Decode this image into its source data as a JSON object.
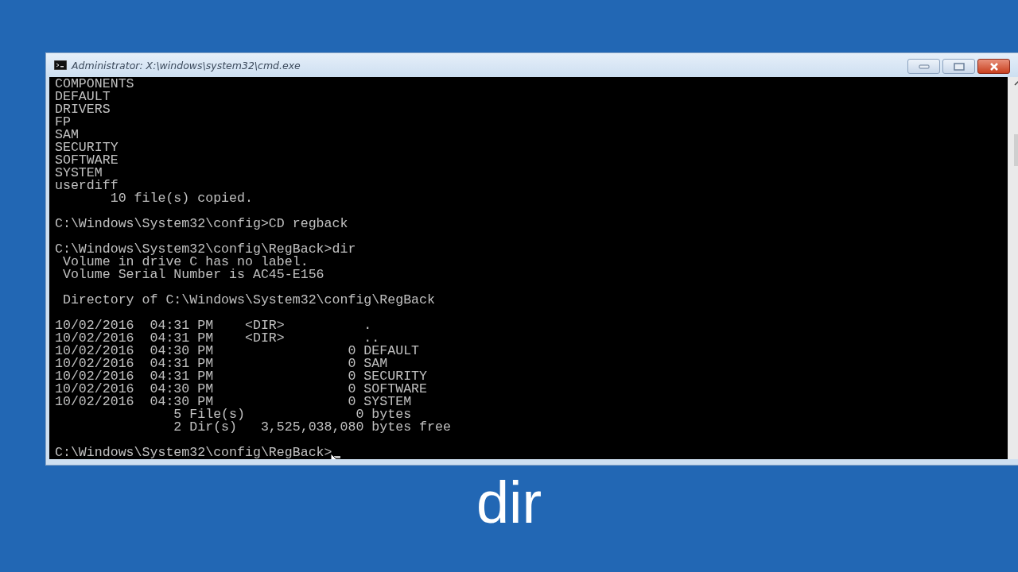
{
  "window": {
    "title": "Administrator: X:\\windows\\system32\\cmd.exe"
  },
  "console": {
    "blocks": [
      [
        "COMPONENTS",
        "DEFAULT",
        "DRIVERS",
        "FP",
        "SAM",
        "SECURITY",
        "SOFTWARE",
        "SYSTEM",
        "userdiff",
        "       10 file(s) copied."
      ],
      [
        "C:\\Windows\\System32\\config>CD regback"
      ],
      [
        "C:\\Windows\\System32\\config\\RegBack>dir",
        " Volume in drive C has no label.",
        " Volume Serial Number is AC45-E156"
      ],
      [
        " Directory of C:\\Windows\\System32\\config\\RegBack"
      ],
      [
        "10/02/2016  04:31 PM    <DIR>          .",
        "10/02/2016  04:31 PM    <DIR>          ..",
        "10/02/2016  04:30 PM                 0 DEFAULT",
        "10/02/2016  04:31 PM                 0 SAM",
        "10/02/2016  04:31 PM                 0 SECURITY",
        "10/02/2016  04:30 PM                 0 SOFTWARE",
        "10/02/2016  04:30 PM                 0 SYSTEM",
        "               5 File(s)              0 bytes",
        "               2 Dir(s)   3,525,038,080 bytes free"
      ],
      [
        "C:\\Windows\\System32\\config\\RegBack>"
      ]
    ]
  },
  "caption": "dir"
}
